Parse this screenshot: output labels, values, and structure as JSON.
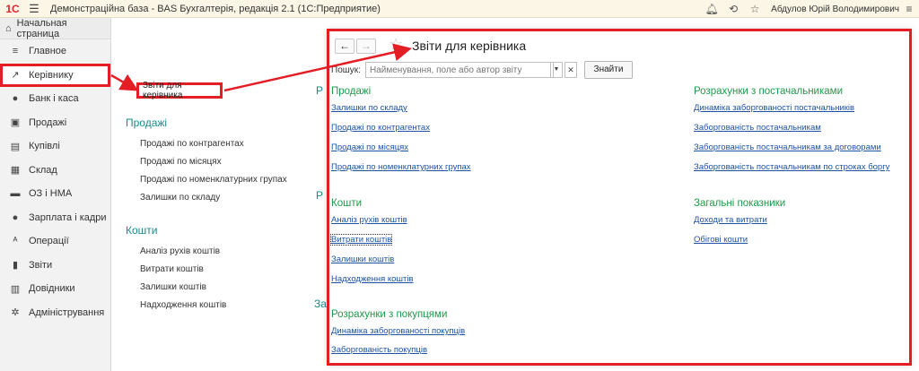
{
  "window": {
    "logo": "1С",
    "title": "Демонстраційна база - BAS Бухгалтерія, редакція 2.1  (1С:Предприятие)",
    "user": "Абдулов Юрій Володимирович"
  },
  "sidebar": {
    "home_label": "Начальная страница",
    "items": [
      {
        "label": "Главное",
        "icon": "≡"
      },
      {
        "label": "Керівнику",
        "icon": "↗"
      },
      {
        "label": "Банк і каса",
        "icon": "●"
      },
      {
        "label": "Продажі",
        "icon": "▣"
      },
      {
        "label": "Купівлі",
        "icon": "▤"
      },
      {
        "label": "Склад",
        "icon": "▦"
      },
      {
        "label": "ОЗ і НМА",
        "icon": "▬"
      },
      {
        "label": "Зарплата і кадри",
        "icon": "●"
      },
      {
        "label": "Операції",
        "icon": "ᴬ"
      },
      {
        "label": "Звіти",
        "icon": "▮"
      },
      {
        "label": "Довідники",
        "icon": "▥"
      },
      {
        "label": "Адміністрування",
        "icon": "✲"
      }
    ]
  },
  "middle": {
    "top_link": "Звіти для керівника",
    "sales_head": "Продажі",
    "sales_items": [
      "Продажі по контрагентах",
      "Продажі по місяцях",
      "Продажі по номенклатурних групах",
      "Залишки по складу"
    ],
    "cash_head": "Кошти",
    "cash_items": [
      "Аналіз рухів коштів",
      "Витрати коштів",
      "Залишки коштів",
      "Надходження коштів"
    ],
    "edge_letters": [
      "Р",
      "Р",
      "За"
    ]
  },
  "popup": {
    "title": "Звіти для керівника",
    "search_label": "Пошук:",
    "search_placeholder": "Найменування, поле або автор звіту",
    "find_button": "Знайти",
    "sections": [
      {
        "title": "Продажі",
        "links": [
          "Залишки по складу",
          "Продажі по контрагентах",
          "Продажі по місяцях",
          "Продажі по номенклатурних групах"
        ]
      },
      {
        "title": "Кошти",
        "links": [
          "Аналіз рухів коштів",
          "Витрати коштів",
          "Залишки коштів",
          "Надходження коштів"
        ]
      },
      {
        "title": "Розрахунки з покупцями",
        "links": [
          "Динаміка заборгованості покупців",
          "Заборгованість покупців"
        ]
      },
      {
        "title": "Розрахунки з постачальниками",
        "links": [
          "Динаміка заборгованості постачальників",
          "Заборгованість постачальникам",
          "Заборгованість постачальникам за договорами",
          "Заборгованість постачальникам по строках боргу"
        ]
      },
      {
        "title": "Загальні показники",
        "links": [
          "Доходи та витрати",
          "Обігові кошти"
        ]
      }
    ]
  },
  "colors": {
    "highlight": "#e31e24",
    "section_green": "#1f9a4a",
    "link_blue": "#1d53a5",
    "teal_head": "#1a8a8a"
  }
}
